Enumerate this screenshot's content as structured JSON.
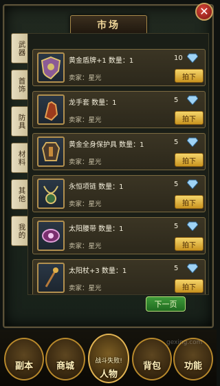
{
  "window": {
    "title": "市场",
    "close_label": "✕"
  },
  "tabs": [
    {
      "label": "武器"
    },
    {
      "label": "首饰"
    },
    {
      "label": "防具"
    },
    {
      "label": "材料"
    },
    {
      "label": "其他"
    },
    {
      "label": "我的"
    }
  ],
  "items": [
    {
      "name": "黄金盾牌+1 数量：1",
      "seller": "卖家：星光",
      "price": "10",
      "buy": "拍下",
      "icon": "shield-icon"
    },
    {
      "name": "龙手套 数量：1",
      "seller": "卖家：星光",
      "price": "5",
      "buy": "拍下",
      "icon": "glove-icon"
    },
    {
      "name": "黄金全身保护具 数量：1",
      "seller": "卖家：星光",
      "price": "5",
      "buy": "拍下",
      "icon": "armor-icon"
    },
    {
      "name": "永恒项链 数量：1",
      "seller": "卖家：星光",
      "price": "5",
      "buy": "拍下",
      "icon": "necklace-icon"
    },
    {
      "name": "太阳腰带 数量：1",
      "seller": "卖家：星光",
      "price": "5",
      "buy": "拍下",
      "icon": "belt-icon"
    },
    {
      "name": "太阳杖+3 数量：1",
      "seller": "卖家：星光",
      "price": "5",
      "buy": "拍下",
      "icon": "staff-icon"
    }
  ],
  "next_page": "下一页",
  "nav": [
    {
      "label": "副本"
    },
    {
      "label": "商城"
    },
    {
      "label": "人物"
    },
    {
      "label": "背包"
    },
    {
      "label": "功能"
    }
  ],
  "center_sub": "战斗失败!",
  "watermark": "gexing.com",
  "colors": {
    "accent_gold": "#c99420",
    "frame": "#5b5138",
    "panel": "#20281f"
  }
}
